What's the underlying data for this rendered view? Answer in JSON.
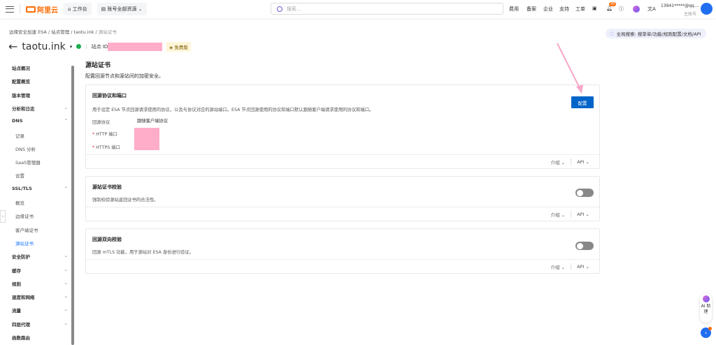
{
  "topbar": {
    "logo": "阿里云",
    "workbench": "工作台",
    "resources": "账号全部资源",
    "search_placeholder": "搜索...",
    "links": [
      "费用",
      "备案",
      "企业",
      "支持",
      "工单"
    ],
    "notif_count": "99",
    "account": "13941*****@qq....",
    "account_role": "主账号"
  },
  "breadcrumb": [
    "边缘安全加速 ESA",
    "站点管理",
    "taotu.ink",
    "源站证书"
  ],
  "site": {
    "name": "taotu.ink",
    "id_label": "站点 ID",
    "plan": "免费版"
  },
  "global_search": "全局搜索: 搜菜单/功能/规则配置/文档/API",
  "sidebar": [
    {
      "label": "站点概况",
      "type": "top"
    },
    {
      "label": "配置概览",
      "type": "top"
    },
    {
      "label": "版本管理",
      "type": "top"
    },
    {
      "label": "分析和日志",
      "type": "group",
      "chev": "down"
    },
    {
      "label": "DNS",
      "type": "group",
      "chev": "up"
    },
    {
      "label": "记录",
      "type": "sub"
    },
    {
      "label": "DNS 分析",
      "type": "sub"
    },
    {
      "label": "SaaS管理器",
      "type": "sub"
    },
    {
      "label": "设置",
      "type": "sub"
    },
    {
      "label": "SSL/TLS",
      "type": "group",
      "chev": "up"
    },
    {
      "label": "概览",
      "type": "sub"
    },
    {
      "label": "边缘证书",
      "type": "sub"
    },
    {
      "label": "客户端证书",
      "type": "sub"
    },
    {
      "label": "源站证书",
      "type": "sub",
      "active": true
    },
    {
      "label": "安全防护",
      "type": "group",
      "chev": "down"
    },
    {
      "label": "缓存",
      "type": "group",
      "chev": "down"
    },
    {
      "label": "规则",
      "type": "group",
      "chev": "down"
    },
    {
      "label": "速度和网络",
      "type": "group",
      "chev": "down"
    },
    {
      "label": "流量",
      "type": "group",
      "chev": "down"
    },
    {
      "label": "四层代理",
      "type": "group",
      "chev": "down"
    },
    {
      "label": "函数路由",
      "type": "top"
    }
  ],
  "main": {
    "title": "源站证书",
    "desc": "配置回源节点和源站间的加密安全。",
    "cards": [
      {
        "title": "回源协议和端口",
        "desc": "用于设定 ESA 节点回源请求使用的协议，以及与协议对应的源站端口。ESA 节点回源使用的协议和端口默认跟随客户端请求使用的协议和端口。",
        "button": "配置",
        "protocol_label": "回源协议",
        "protocol_value": "跟随客户端协议",
        "http_label": "HTTP 端口",
        "https_label": "HTTPS 端口"
      },
      {
        "title": "源站证书校验",
        "desc": "强制校验源站返回证书的合法性。",
        "enabled": false
      },
      {
        "title": "回源双向校验",
        "desc": "回源 mTLS 功能，用于源站对 ESA 身份进行验证。",
        "enabled": false
      }
    ],
    "footer_intro": "介绍",
    "footer_api": "API"
  },
  "ai_assistant": "AI 助理"
}
